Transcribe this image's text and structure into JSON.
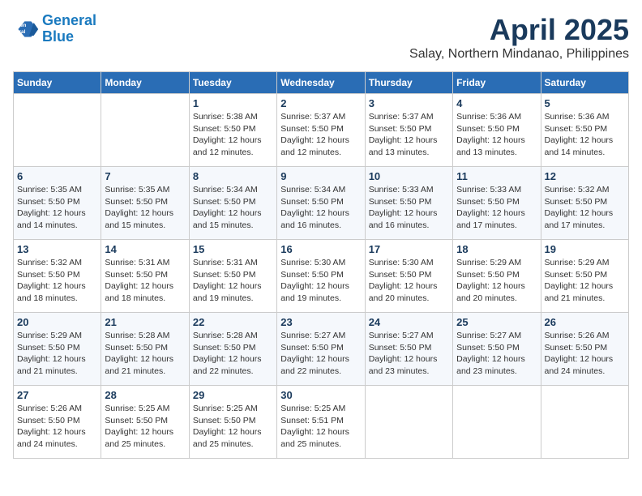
{
  "header": {
    "logo_line1": "General",
    "logo_line2": "Blue",
    "month_title": "April 2025",
    "location": "Salay, Northern Mindanao, Philippines"
  },
  "weekdays": [
    "Sunday",
    "Monday",
    "Tuesday",
    "Wednesday",
    "Thursday",
    "Friday",
    "Saturday"
  ],
  "weeks": [
    [
      {
        "day": null
      },
      {
        "day": null
      },
      {
        "day": "1",
        "sunrise": "Sunrise: 5:38 AM",
        "sunset": "Sunset: 5:50 PM",
        "daylight": "Daylight: 12 hours and 12 minutes."
      },
      {
        "day": "2",
        "sunrise": "Sunrise: 5:37 AM",
        "sunset": "Sunset: 5:50 PM",
        "daylight": "Daylight: 12 hours and 12 minutes."
      },
      {
        "day": "3",
        "sunrise": "Sunrise: 5:37 AM",
        "sunset": "Sunset: 5:50 PM",
        "daylight": "Daylight: 12 hours and 13 minutes."
      },
      {
        "day": "4",
        "sunrise": "Sunrise: 5:36 AM",
        "sunset": "Sunset: 5:50 PM",
        "daylight": "Daylight: 12 hours and 13 minutes."
      },
      {
        "day": "5",
        "sunrise": "Sunrise: 5:36 AM",
        "sunset": "Sunset: 5:50 PM",
        "daylight": "Daylight: 12 hours and 14 minutes."
      }
    ],
    [
      {
        "day": "6",
        "sunrise": "Sunrise: 5:35 AM",
        "sunset": "Sunset: 5:50 PM",
        "daylight": "Daylight: 12 hours and 14 minutes."
      },
      {
        "day": "7",
        "sunrise": "Sunrise: 5:35 AM",
        "sunset": "Sunset: 5:50 PM",
        "daylight": "Daylight: 12 hours and 15 minutes."
      },
      {
        "day": "8",
        "sunrise": "Sunrise: 5:34 AM",
        "sunset": "Sunset: 5:50 PM",
        "daylight": "Daylight: 12 hours and 15 minutes."
      },
      {
        "day": "9",
        "sunrise": "Sunrise: 5:34 AM",
        "sunset": "Sunset: 5:50 PM",
        "daylight": "Daylight: 12 hours and 16 minutes."
      },
      {
        "day": "10",
        "sunrise": "Sunrise: 5:33 AM",
        "sunset": "Sunset: 5:50 PM",
        "daylight": "Daylight: 12 hours and 16 minutes."
      },
      {
        "day": "11",
        "sunrise": "Sunrise: 5:33 AM",
        "sunset": "Sunset: 5:50 PM",
        "daylight": "Daylight: 12 hours and 17 minutes."
      },
      {
        "day": "12",
        "sunrise": "Sunrise: 5:32 AM",
        "sunset": "Sunset: 5:50 PM",
        "daylight": "Daylight: 12 hours and 17 minutes."
      }
    ],
    [
      {
        "day": "13",
        "sunrise": "Sunrise: 5:32 AM",
        "sunset": "Sunset: 5:50 PM",
        "daylight": "Daylight: 12 hours and 18 minutes."
      },
      {
        "day": "14",
        "sunrise": "Sunrise: 5:31 AM",
        "sunset": "Sunset: 5:50 PM",
        "daylight": "Daylight: 12 hours and 18 minutes."
      },
      {
        "day": "15",
        "sunrise": "Sunrise: 5:31 AM",
        "sunset": "Sunset: 5:50 PM",
        "daylight": "Daylight: 12 hours and 19 minutes."
      },
      {
        "day": "16",
        "sunrise": "Sunrise: 5:30 AM",
        "sunset": "Sunset: 5:50 PM",
        "daylight": "Daylight: 12 hours and 19 minutes."
      },
      {
        "day": "17",
        "sunrise": "Sunrise: 5:30 AM",
        "sunset": "Sunset: 5:50 PM",
        "daylight": "Daylight: 12 hours and 20 minutes."
      },
      {
        "day": "18",
        "sunrise": "Sunrise: 5:29 AM",
        "sunset": "Sunset: 5:50 PM",
        "daylight": "Daylight: 12 hours and 20 minutes."
      },
      {
        "day": "19",
        "sunrise": "Sunrise: 5:29 AM",
        "sunset": "Sunset: 5:50 PM",
        "daylight": "Daylight: 12 hours and 21 minutes."
      }
    ],
    [
      {
        "day": "20",
        "sunrise": "Sunrise: 5:29 AM",
        "sunset": "Sunset: 5:50 PM",
        "daylight": "Daylight: 12 hours and 21 minutes."
      },
      {
        "day": "21",
        "sunrise": "Sunrise: 5:28 AM",
        "sunset": "Sunset: 5:50 PM",
        "daylight": "Daylight: 12 hours and 21 minutes."
      },
      {
        "day": "22",
        "sunrise": "Sunrise: 5:28 AM",
        "sunset": "Sunset: 5:50 PM",
        "daylight": "Daylight: 12 hours and 22 minutes."
      },
      {
        "day": "23",
        "sunrise": "Sunrise: 5:27 AM",
        "sunset": "Sunset: 5:50 PM",
        "daylight": "Daylight: 12 hours and 22 minutes."
      },
      {
        "day": "24",
        "sunrise": "Sunrise: 5:27 AM",
        "sunset": "Sunset: 5:50 PM",
        "daylight": "Daylight: 12 hours and 23 minutes."
      },
      {
        "day": "25",
        "sunrise": "Sunrise: 5:27 AM",
        "sunset": "Sunset: 5:50 PM",
        "daylight": "Daylight: 12 hours and 23 minutes."
      },
      {
        "day": "26",
        "sunrise": "Sunrise: 5:26 AM",
        "sunset": "Sunset: 5:50 PM",
        "daylight": "Daylight: 12 hours and 24 minutes."
      }
    ],
    [
      {
        "day": "27",
        "sunrise": "Sunrise: 5:26 AM",
        "sunset": "Sunset: 5:50 PM",
        "daylight": "Daylight: 12 hours and 24 minutes."
      },
      {
        "day": "28",
        "sunrise": "Sunrise: 5:25 AM",
        "sunset": "Sunset: 5:50 PM",
        "daylight": "Daylight: 12 hours and 25 minutes."
      },
      {
        "day": "29",
        "sunrise": "Sunrise: 5:25 AM",
        "sunset": "Sunset: 5:50 PM",
        "daylight": "Daylight: 12 hours and 25 minutes."
      },
      {
        "day": "30",
        "sunrise": "Sunrise: 5:25 AM",
        "sunset": "Sunset: 5:51 PM",
        "daylight": "Daylight: 12 hours and 25 minutes."
      },
      {
        "day": null
      },
      {
        "day": null
      },
      {
        "day": null
      }
    ]
  ]
}
